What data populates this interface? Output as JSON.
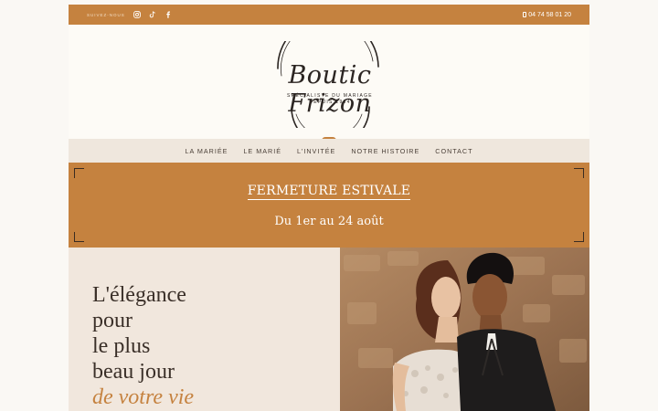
{
  "topbar": {
    "follow_label": "SUIVEZ-NOUS",
    "social": [
      "instagram-icon",
      "tiktok-icon",
      "facebook-icon"
    ],
    "phone": "04 74 58 01 20"
  },
  "logo": {
    "script": "Boutic Frizon",
    "tagline_1": "SPÉCIALISTE DU MARIAGE",
    "tagline_2": "DEPUIS 1964"
  },
  "nav": {
    "items": [
      "LA MARIÉE",
      "LE MARIÉ",
      "L'INVITÉE",
      "NOTRE HISTOIRE",
      "CONTACT"
    ]
  },
  "banner": {
    "title": "FERMETURE ESTIVALE",
    "subtitle": "Du 1er au 24 août"
  },
  "hero": {
    "line_1": "L'élégance",
    "line_2": "pour",
    "line_3": "le plus",
    "line_4": "beau jour",
    "line_5": "de votre vie"
  },
  "colors": {
    "accent": "#c5823f",
    "nav_bg": "#efe7dd",
    "hero_bg": "#f1e7dd",
    "text_dark": "#3a2f28"
  }
}
